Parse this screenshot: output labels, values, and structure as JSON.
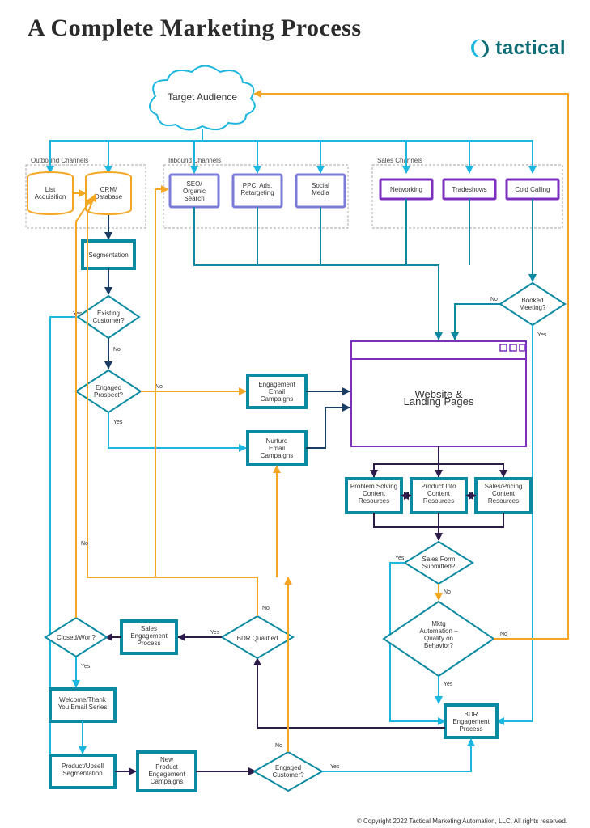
{
  "title": "A Complete Marketing Process",
  "brand": "tactical",
  "colors": {
    "cyan": "#1cb7e0",
    "teal": "#0c8aa2",
    "purple": "#7b2fbf",
    "darkpurple": "#2d1b4a",
    "orange": "#f5a623",
    "navy": "#1a3d66"
  },
  "sections": {
    "outbound": "Outbound Channels",
    "inbound": "Inbound Channels",
    "sales": "Sales Channels"
  },
  "nodes": {
    "target": "Target Audience",
    "list_acq": "List\nAcquisition",
    "crm": "CRM/\nDatabase",
    "seo": "SEO/\nOrganic\nSearch",
    "ppc": "PPC, Ads,\nRetargeting",
    "social": "Social\nMedia",
    "networking": "Networking",
    "tradeshows": "Tradeshows",
    "coldcall": "Cold Calling",
    "segmentation": "Segmentation",
    "existing": "Existing\nCustomer?",
    "engaged": "Engaged\nProspect?",
    "eng_email": "Engagement\nEmail\nCampaigns",
    "nur_email": "Nurture\nEmail\nCampaigns",
    "website": "Website &\nLanding Pages",
    "problem": "Problem Solving\nContent\nResources",
    "prodinfo": "Product Info\nContent\nResources",
    "pricing": "Sales/Pricing\nContent\nResources",
    "salesform": "Sales Form\nSubmitted?",
    "mktgauto": "Mktg\nAutomation –\nQualify on\nBehavior?",
    "bdrproc": "BDR\nEngagement\nProcess",
    "bdrqual": "BDR Qualified",
    "salesengage": "Sales\nEngagement\nProcess",
    "closedwon": "Closed/Won?",
    "welcome": "Welcome/Thank\nYou Email Series",
    "prodseg": "Product/Upsell\nSegmentation",
    "newprod": "New\nProduct\nEngagement\nCampaigns",
    "engcust": "Engaged\nCustomer?",
    "bookedmtg": "Booked\nMeeting?"
  },
  "labels": {
    "yes": "Yes",
    "no": "No"
  },
  "copyright": "© Copyright 2022 Tactical Marketing Automation, LLC, All rights reserved."
}
